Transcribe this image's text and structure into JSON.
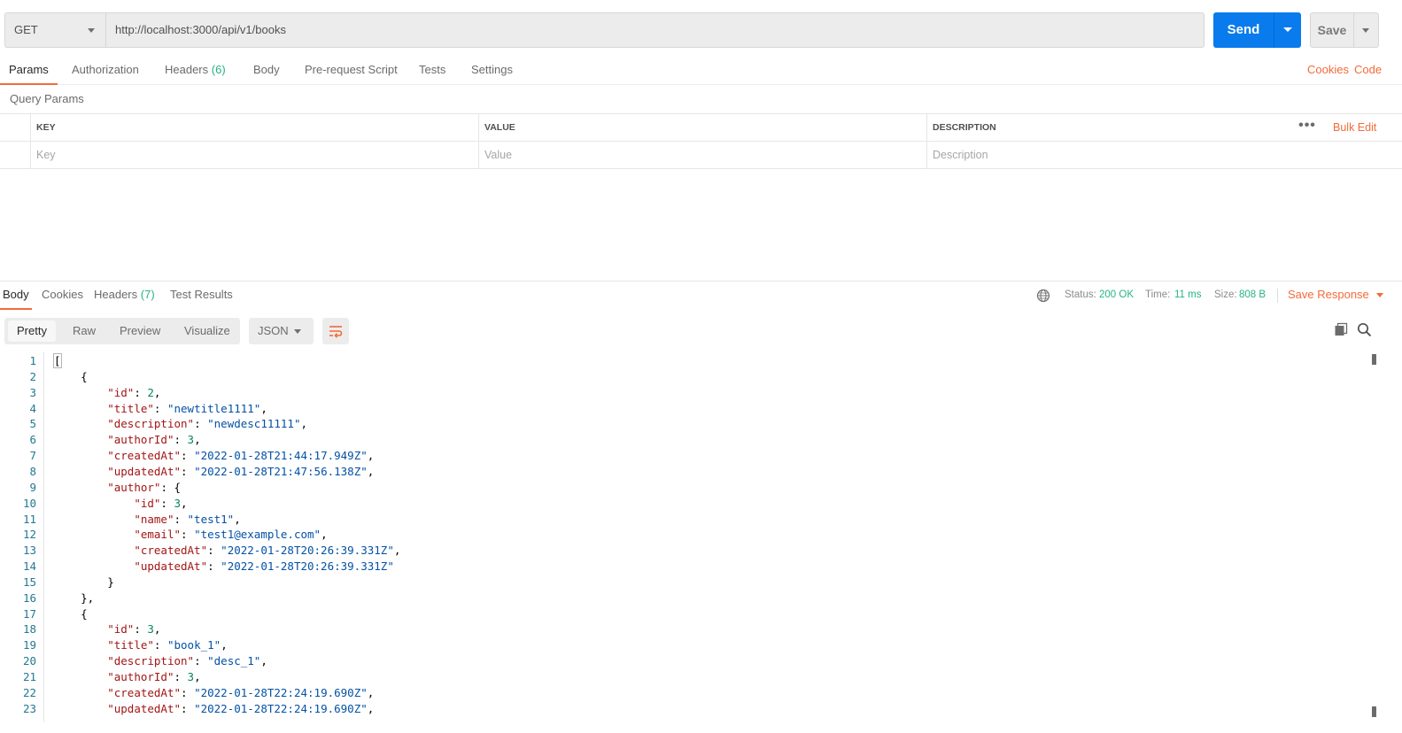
{
  "request": {
    "method": "GET",
    "url": "http://localhost:3000/api/v1/books",
    "send_label": "Send",
    "save_label": "Save"
  },
  "request_tabs": [
    {
      "label": "Params",
      "active": true
    },
    {
      "label": "Authorization"
    },
    {
      "label": "Headers",
      "count": "(6)"
    },
    {
      "label": "Body"
    },
    {
      "label": "Pre-request Script"
    },
    {
      "label": "Tests"
    },
    {
      "label": "Settings"
    }
  ],
  "right_links": {
    "cookies": "Cookies",
    "code": "Code"
  },
  "query_params": {
    "title": "Query Params",
    "columns": [
      "KEY",
      "VALUE",
      "DESCRIPTION"
    ],
    "placeholders": [
      "Key",
      "Value",
      "Description"
    ],
    "more": "•••",
    "bulk_edit": "Bulk Edit"
  },
  "response_tabs": [
    {
      "label": "Body",
      "active": true
    },
    {
      "label": "Cookies"
    },
    {
      "label": "Headers",
      "count": "(7)"
    },
    {
      "label": "Test Results"
    }
  ],
  "response_status": {
    "status_label": "Status:",
    "status_value": "200 OK",
    "time_label": "Time:",
    "time_value": "11 ms",
    "size_label": "Size:",
    "size_value": "808 B",
    "save_response": "Save Response"
  },
  "view_modes": [
    "Pretty",
    "Raw",
    "Preview",
    "Visualize"
  ],
  "format": "JSON",
  "colors": {
    "accent": "#f26b3a",
    "send": "#097bed",
    "success": "#26b47f"
  },
  "code_lines": [
    [
      [
        "p",
        "["
      ]
    ],
    [
      [
        "p",
        "    {"
      ]
    ],
    [
      [
        "p",
        "        "
      ],
      [
        "key",
        "\"id\""
      ],
      [
        "p",
        ": "
      ],
      [
        "num",
        "2"
      ],
      [
        "p",
        ","
      ]
    ],
    [
      [
        "p",
        "        "
      ],
      [
        "key",
        "\"title\""
      ],
      [
        "p",
        ": "
      ],
      [
        "str",
        "\"newtitle1111\""
      ],
      [
        "p",
        ","
      ]
    ],
    [
      [
        "p",
        "        "
      ],
      [
        "key",
        "\"description\""
      ],
      [
        "p",
        ": "
      ],
      [
        "str",
        "\"newdesc11111\""
      ],
      [
        "p",
        ","
      ]
    ],
    [
      [
        "p",
        "        "
      ],
      [
        "key",
        "\"authorId\""
      ],
      [
        "p",
        ": "
      ],
      [
        "num",
        "3"
      ],
      [
        "p",
        ","
      ]
    ],
    [
      [
        "p",
        "        "
      ],
      [
        "key",
        "\"createdAt\""
      ],
      [
        "p",
        ": "
      ],
      [
        "str",
        "\"2022-01-28T21:44:17.949Z\""
      ],
      [
        "p",
        ","
      ]
    ],
    [
      [
        "p",
        "        "
      ],
      [
        "key",
        "\"updatedAt\""
      ],
      [
        "p",
        ": "
      ],
      [
        "str",
        "\"2022-01-28T21:47:56.138Z\""
      ],
      [
        "p",
        ","
      ]
    ],
    [
      [
        "p",
        "        "
      ],
      [
        "key",
        "\"author\""
      ],
      [
        "p",
        ": {"
      ]
    ],
    [
      [
        "p",
        "            "
      ],
      [
        "key",
        "\"id\""
      ],
      [
        "p",
        ": "
      ],
      [
        "num",
        "3"
      ],
      [
        "p",
        ","
      ]
    ],
    [
      [
        "p",
        "            "
      ],
      [
        "key",
        "\"name\""
      ],
      [
        "p",
        ": "
      ],
      [
        "str",
        "\"test1\""
      ],
      [
        "p",
        ","
      ]
    ],
    [
      [
        "p",
        "            "
      ],
      [
        "key",
        "\"email\""
      ],
      [
        "p",
        ": "
      ],
      [
        "str",
        "\"test1@example.com\""
      ],
      [
        "p",
        ","
      ]
    ],
    [
      [
        "p",
        "            "
      ],
      [
        "key",
        "\"createdAt\""
      ],
      [
        "p",
        ": "
      ],
      [
        "str",
        "\"2022-01-28T20:26:39.331Z\""
      ],
      [
        "p",
        ","
      ]
    ],
    [
      [
        "p",
        "            "
      ],
      [
        "key",
        "\"updatedAt\""
      ],
      [
        "p",
        ": "
      ],
      [
        "str",
        "\"2022-01-28T20:26:39.331Z\""
      ]
    ],
    [
      [
        "p",
        "        }"
      ]
    ],
    [
      [
        "p",
        "    },"
      ]
    ],
    [
      [
        "p",
        "    {"
      ]
    ],
    [
      [
        "p",
        "        "
      ],
      [
        "key",
        "\"id\""
      ],
      [
        "p",
        ": "
      ],
      [
        "num",
        "3"
      ],
      [
        "p",
        ","
      ]
    ],
    [
      [
        "p",
        "        "
      ],
      [
        "key",
        "\"title\""
      ],
      [
        "p",
        ": "
      ],
      [
        "str",
        "\"book_1\""
      ],
      [
        "p",
        ","
      ]
    ],
    [
      [
        "p",
        "        "
      ],
      [
        "key",
        "\"description\""
      ],
      [
        "p",
        ": "
      ],
      [
        "str",
        "\"desc_1\""
      ],
      [
        "p",
        ","
      ]
    ],
    [
      [
        "p",
        "        "
      ],
      [
        "key",
        "\"authorId\""
      ],
      [
        "p",
        ": "
      ],
      [
        "num",
        "3"
      ],
      [
        "p",
        ","
      ]
    ],
    [
      [
        "p",
        "        "
      ],
      [
        "key",
        "\"createdAt\""
      ],
      [
        "p",
        ": "
      ],
      [
        "str",
        "\"2022-01-28T22:24:19.690Z\""
      ],
      [
        "p",
        ","
      ]
    ],
    [
      [
        "p",
        "        "
      ],
      [
        "key",
        "\"updatedAt\""
      ],
      [
        "p",
        ": "
      ],
      [
        "str",
        "\"2022-01-28T22:24:19.690Z\""
      ],
      [
        "p",
        ","
      ]
    ]
  ]
}
